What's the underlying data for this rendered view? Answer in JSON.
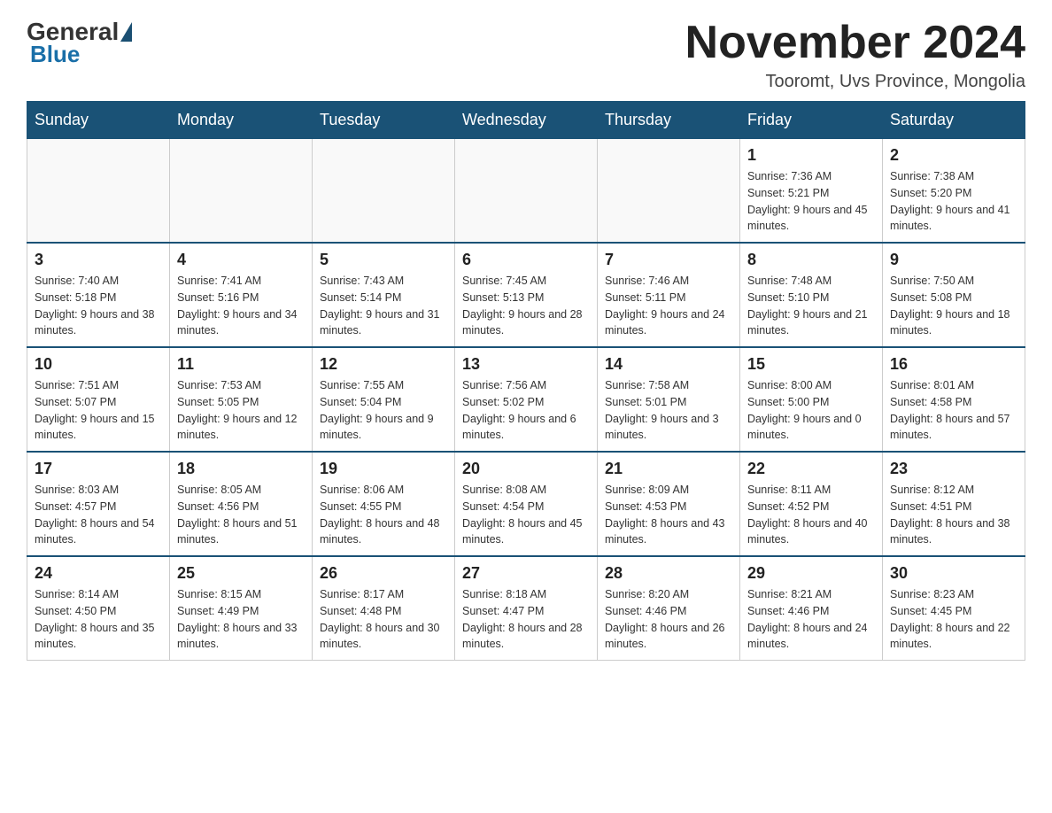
{
  "header": {
    "month_title": "November 2024",
    "location": "Tooromt, Uvs Province, Mongolia",
    "logo_general": "General",
    "logo_blue": "Blue"
  },
  "weekdays": [
    "Sunday",
    "Monday",
    "Tuesday",
    "Wednesday",
    "Thursday",
    "Friday",
    "Saturday"
  ],
  "weeks": [
    [
      {
        "day": "",
        "info": ""
      },
      {
        "day": "",
        "info": ""
      },
      {
        "day": "",
        "info": ""
      },
      {
        "day": "",
        "info": ""
      },
      {
        "day": "",
        "info": ""
      },
      {
        "day": "1",
        "info": "Sunrise: 7:36 AM\nSunset: 5:21 PM\nDaylight: 9 hours and 45 minutes."
      },
      {
        "day": "2",
        "info": "Sunrise: 7:38 AM\nSunset: 5:20 PM\nDaylight: 9 hours and 41 minutes."
      }
    ],
    [
      {
        "day": "3",
        "info": "Sunrise: 7:40 AM\nSunset: 5:18 PM\nDaylight: 9 hours and 38 minutes."
      },
      {
        "day": "4",
        "info": "Sunrise: 7:41 AM\nSunset: 5:16 PM\nDaylight: 9 hours and 34 minutes."
      },
      {
        "day": "5",
        "info": "Sunrise: 7:43 AM\nSunset: 5:14 PM\nDaylight: 9 hours and 31 minutes."
      },
      {
        "day": "6",
        "info": "Sunrise: 7:45 AM\nSunset: 5:13 PM\nDaylight: 9 hours and 28 minutes."
      },
      {
        "day": "7",
        "info": "Sunrise: 7:46 AM\nSunset: 5:11 PM\nDaylight: 9 hours and 24 minutes."
      },
      {
        "day": "8",
        "info": "Sunrise: 7:48 AM\nSunset: 5:10 PM\nDaylight: 9 hours and 21 minutes."
      },
      {
        "day": "9",
        "info": "Sunrise: 7:50 AM\nSunset: 5:08 PM\nDaylight: 9 hours and 18 minutes."
      }
    ],
    [
      {
        "day": "10",
        "info": "Sunrise: 7:51 AM\nSunset: 5:07 PM\nDaylight: 9 hours and 15 minutes."
      },
      {
        "day": "11",
        "info": "Sunrise: 7:53 AM\nSunset: 5:05 PM\nDaylight: 9 hours and 12 minutes."
      },
      {
        "day": "12",
        "info": "Sunrise: 7:55 AM\nSunset: 5:04 PM\nDaylight: 9 hours and 9 minutes."
      },
      {
        "day": "13",
        "info": "Sunrise: 7:56 AM\nSunset: 5:02 PM\nDaylight: 9 hours and 6 minutes."
      },
      {
        "day": "14",
        "info": "Sunrise: 7:58 AM\nSunset: 5:01 PM\nDaylight: 9 hours and 3 minutes."
      },
      {
        "day": "15",
        "info": "Sunrise: 8:00 AM\nSunset: 5:00 PM\nDaylight: 9 hours and 0 minutes."
      },
      {
        "day": "16",
        "info": "Sunrise: 8:01 AM\nSunset: 4:58 PM\nDaylight: 8 hours and 57 minutes."
      }
    ],
    [
      {
        "day": "17",
        "info": "Sunrise: 8:03 AM\nSunset: 4:57 PM\nDaylight: 8 hours and 54 minutes."
      },
      {
        "day": "18",
        "info": "Sunrise: 8:05 AM\nSunset: 4:56 PM\nDaylight: 8 hours and 51 minutes."
      },
      {
        "day": "19",
        "info": "Sunrise: 8:06 AM\nSunset: 4:55 PM\nDaylight: 8 hours and 48 minutes."
      },
      {
        "day": "20",
        "info": "Sunrise: 8:08 AM\nSunset: 4:54 PM\nDaylight: 8 hours and 45 minutes."
      },
      {
        "day": "21",
        "info": "Sunrise: 8:09 AM\nSunset: 4:53 PM\nDaylight: 8 hours and 43 minutes."
      },
      {
        "day": "22",
        "info": "Sunrise: 8:11 AM\nSunset: 4:52 PM\nDaylight: 8 hours and 40 minutes."
      },
      {
        "day": "23",
        "info": "Sunrise: 8:12 AM\nSunset: 4:51 PM\nDaylight: 8 hours and 38 minutes."
      }
    ],
    [
      {
        "day": "24",
        "info": "Sunrise: 8:14 AM\nSunset: 4:50 PM\nDaylight: 8 hours and 35 minutes."
      },
      {
        "day": "25",
        "info": "Sunrise: 8:15 AM\nSunset: 4:49 PM\nDaylight: 8 hours and 33 minutes."
      },
      {
        "day": "26",
        "info": "Sunrise: 8:17 AM\nSunset: 4:48 PM\nDaylight: 8 hours and 30 minutes."
      },
      {
        "day": "27",
        "info": "Sunrise: 8:18 AM\nSunset: 4:47 PM\nDaylight: 8 hours and 28 minutes."
      },
      {
        "day": "28",
        "info": "Sunrise: 8:20 AM\nSunset: 4:46 PM\nDaylight: 8 hours and 26 minutes."
      },
      {
        "day": "29",
        "info": "Sunrise: 8:21 AM\nSunset: 4:46 PM\nDaylight: 8 hours and 24 minutes."
      },
      {
        "day": "30",
        "info": "Sunrise: 8:23 AM\nSunset: 4:45 PM\nDaylight: 8 hours and 22 minutes."
      }
    ]
  ]
}
